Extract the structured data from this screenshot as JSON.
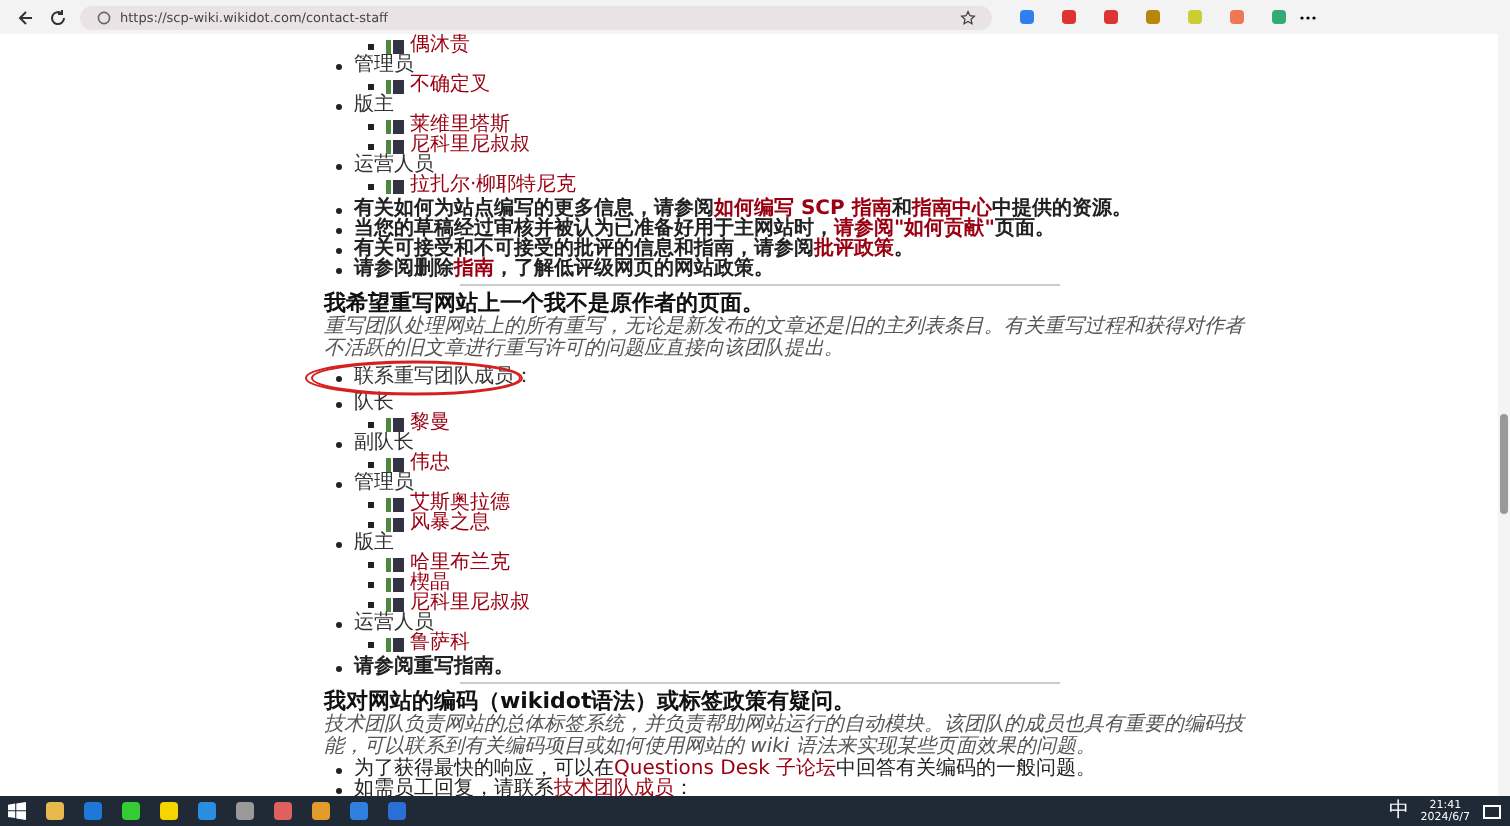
{
  "browser": {
    "url": "https://scp-wiki.wikidot.com/contact-staff"
  },
  "top_list": {
    "members": [
      {
        "name": "偶沐贵"
      }
    ],
    "groups": [
      {
        "role": "管理员",
        "members": [
          {
            "name": "不确定叉"
          }
        ]
      },
      {
        "role": "版主",
        "members": [
          {
            "name": "莱维里塔斯"
          },
          {
            "name": "尼科里尼叔叔"
          }
        ]
      },
      {
        "role": "运营人员",
        "members": [
          {
            "name": "拉扎尔·柳耶特尼克"
          }
        ]
      }
    ]
  },
  "notes": [
    {
      "segments": [
        {
          "text": "有关如何为站点编写的更多信息，请参阅"
        },
        {
          "link": "如何编写 SCP 指南"
        },
        {
          "text": "和"
        },
        {
          "link": "指南中心"
        },
        {
          "text": "中提供的资源。"
        }
      ]
    },
    {
      "segments": [
        {
          "text": "当您的草稿经过审核并被认为已准备好用于主网站时，"
        },
        {
          "link": "请参阅\"如何贡献\""
        },
        {
          "text": "页面。"
        }
      ]
    },
    {
      "segments": [
        {
          "text": "有关可接受和不可接受的批评的信息和指南，请参阅"
        },
        {
          "link": "批评政策"
        },
        {
          "text": "。"
        }
      ]
    },
    {
      "segments": [
        {
          "text": "请参阅删除"
        },
        {
          "link": "指南"
        },
        {
          "text": "，了解低评级网页的网站政策。"
        }
      ]
    }
  ],
  "rewrite": {
    "heading": "我希望重写网站上一个我不是原作者的页面。",
    "intro": "重写团队处理网站上的所有重写，无论是新发布的文章还是旧的主列表条目。有关重写过程和获得对作者不活跃的旧文章进行重写许可的问题应直接向该团队提出。",
    "contact": "联系重写团队成员：",
    "groups": [
      {
        "role": "队长",
        "members": [
          {
            "name": "黎曼"
          }
        ]
      },
      {
        "role": "副队长",
        "members": [
          {
            "name": "伟忠"
          }
        ]
      },
      {
        "role": "管理员",
        "members": [
          {
            "name": "艾斯奥拉德"
          },
          {
            "name": "风暴之息"
          }
        ]
      },
      {
        "role": "版主",
        "members": [
          {
            "name": "哈里布兰克"
          },
          {
            "name": "楔晶"
          },
          {
            "name": "尼科里尼叔叔"
          }
        ]
      },
      {
        "role": "运营人员",
        "members": [
          {
            "name": "鲁萨科"
          }
        ]
      }
    ],
    "note": "请参阅重写指南。"
  },
  "tech": {
    "heading": "我对网站的编码（wikidot语法）或标签政策有疑问。",
    "intro": "技术团队负责网站的总体标签系统，并负责帮助网站运行的自动模块。该团队的成员也具有重要的编码技能，可以联系到有关编码项目或如何使用网站的 wiki 语法来实现某些页面效果的问题。",
    "notes": [
      {
        "segments": [
          {
            "text": "为了获得最快的响应，可以在"
          },
          {
            "link": "Questions Desk 子论坛"
          },
          {
            "text": "中回答有关编码的一般问题。"
          }
        ]
      },
      {
        "segments": [
          {
            "text": "如需员工回复，请联系"
          },
          {
            "link": "技术团队成员"
          },
          {
            "text": "："
          }
        ]
      }
    ]
  },
  "taskbar": {
    "ime": "中",
    "time": "21:41",
    "date": "2024/6/7"
  }
}
